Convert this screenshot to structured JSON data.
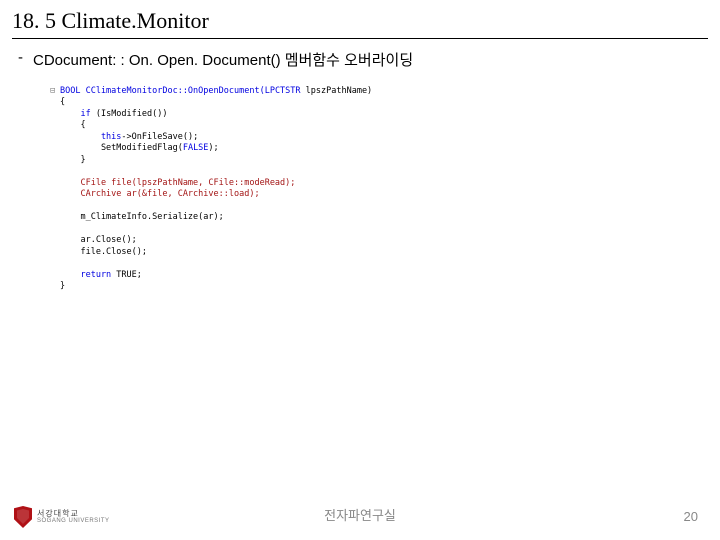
{
  "title": "18. 5 Climate.Monitor",
  "bullet": {
    "dash": "-",
    "text": "CDocument: : On. Open. Document() 멤버함수 오버라이딩"
  },
  "footer": {
    "center": "전자파연구실",
    "page": "20",
    "logo_kr": "서강대학교",
    "logo_en": "SOGANG UNIVERSITY"
  },
  "code": {
    "l1a": "BOOL CClimateMonitorDoc::OnOpenDocument(",
    "l1b": "LPCTSTR",
    "l1c": " lpszPathName)",
    "l2": "{",
    "l3a": "    if",
    "l3b": " (IsModified())",
    "l4": "    {",
    "l5a": "        this",
    "l5b": "->OnFileSave();",
    "l6a": "        SetModifiedFlag(",
    "l6b": "FALSE",
    "l6c": ");",
    "l7": "    }",
    "l9": "    CFile file(lpszPathName, CFile::modeRead);",
    "l10": "    CArchive ar(&file, CArchive::load);",
    "l12": "    m_ClimateInfo.Serialize(ar);",
    "l14": "    ar.Close();",
    "l15": "    file.Close();",
    "l17a": "    return",
    "l17b": " TRUE;",
    "l18": "}"
  }
}
